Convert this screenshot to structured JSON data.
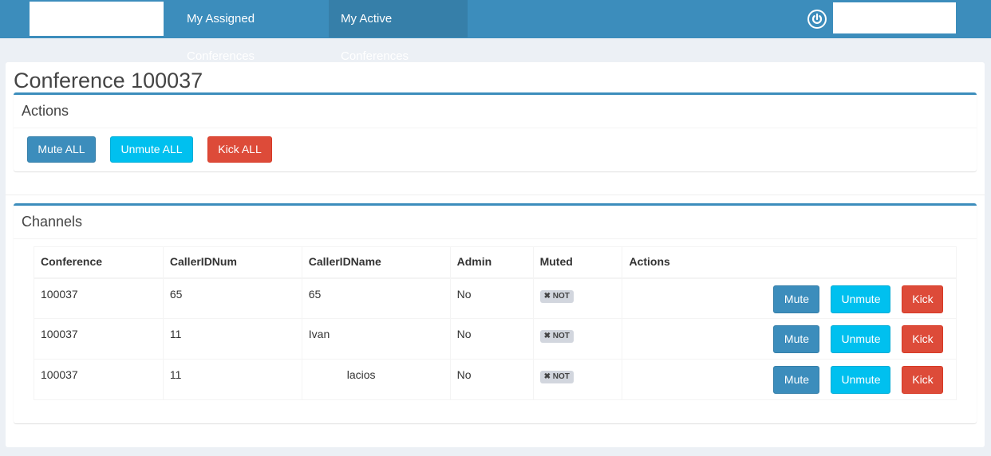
{
  "nav": {
    "assigned": "My Assigned Conferences",
    "active": "My Active Conferences",
    "power_icon": "power-icon"
  },
  "page": {
    "title": "Conference 100037"
  },
  "actions_box": {
    "title": "Actions",
    "mute_all": "Mute ALL",
    "unmute_all": "Unmute ALL",
    "kick_all": "Kick ALL"
  },
  "channels_box": {
    "title": "Channels",
    "columns": [
      "Conference",
      "CallerIDNum",
      "CallerIDName",
      "Admin",
      "Muted",
      "Actions"
    ],
    "rows": [
      {
        "conference": "100037",
        "calleridnum": "65",
        "calleridname": "65",
        "admin": "No",
        "muted": "NOT",
        "mute": "Mute",
        "unmute": "Unmute",
        "kick": "Kick"
      },
      {
        "conference": "100037",
        "calleridnum": "11",
        "calleridname": "Ivan",
        "admin": "No",
        "muted": "NOT",
        "mute": "Mute",
        "unmute": "Unmute",
        "kick": "Kick"
      },
      {
        "conference": "100037",
        "calleridnum": "11",
        "calleridname": "lacios",
        "admin": "No",
        "muted": "NOT",
        "mute": "Mute",
        "unmute": "Unmute",
        "kick": "Kick"
      }
    ]
  },
  "colors": {
    "primary": "#3c8dbc",
    "info": "#00c0ef",
    "danger": "#dd4b39",
    "label_default": "#d2d6de"
  }
}
